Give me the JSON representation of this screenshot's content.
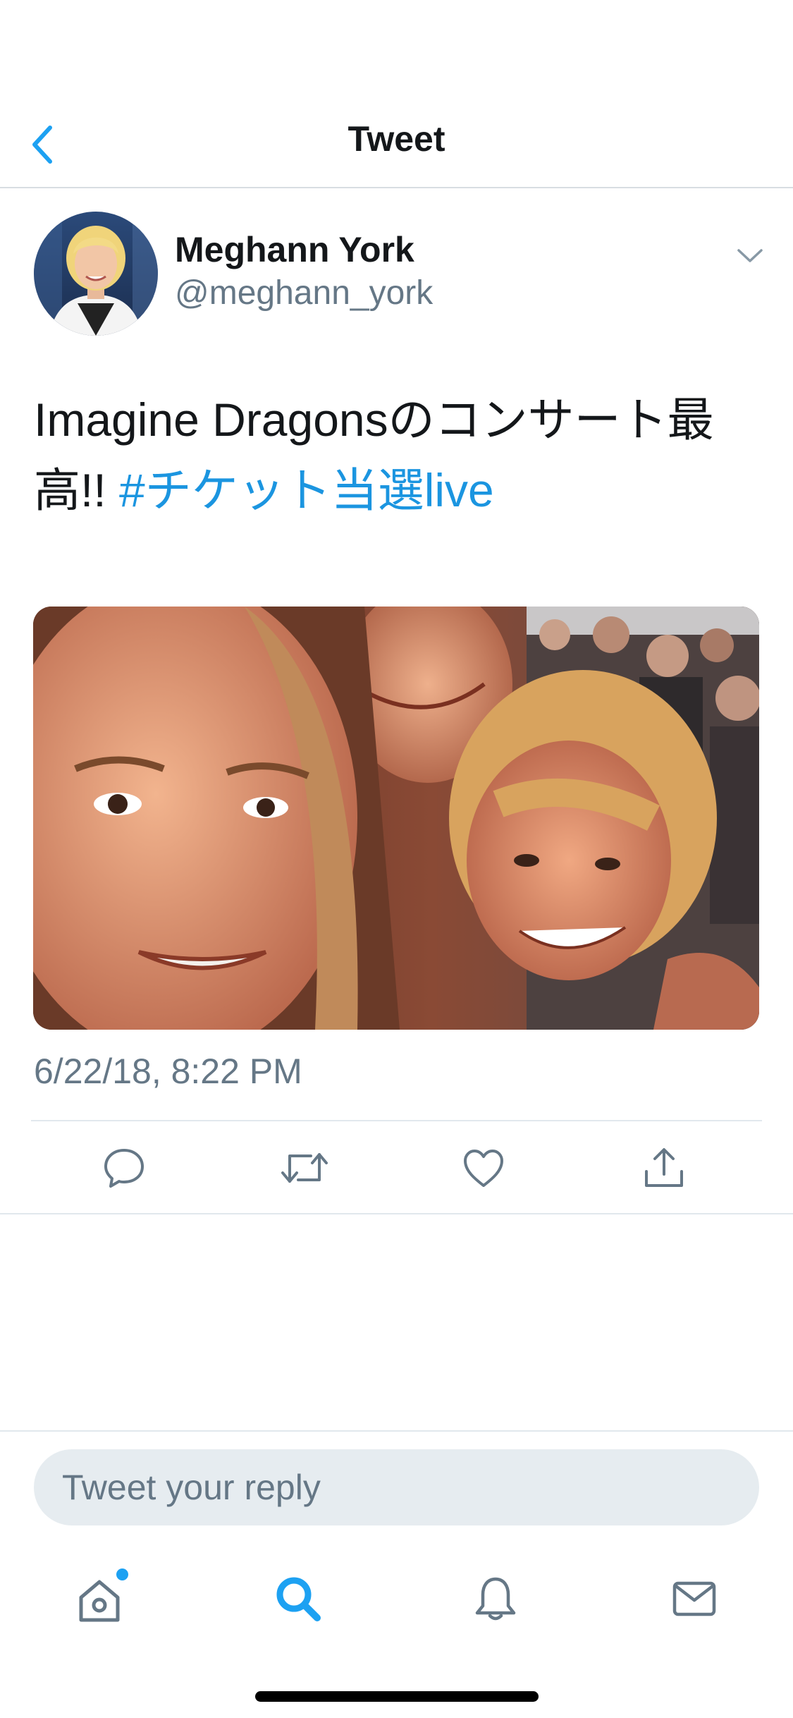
{
  "header": {
    "title": "Tweet"
  },
  "tweet": {
    "author": {
      "name": "Meghann York",
      "handle": "@meghann_york"
    },
    "text_plain": "Imagine Dragonsのコンサート最高!! ",
    "hashtag": "#チケット当選live",
    "timestamp": "6/22/18, 8:22 PM"
  },
  "actions": {
    "reply_icon": "reply-icon",
    "retweet_icon": "retweet-icon",
    "like_icon": "heart-icon",
    "share_icon": "share-icon"
  },
  "reply": {
    "placeholder": "Tweet your reply"
  },
  "tabbar": {
    "items": [
      "home-icon",
      "search-icon",
      "notifications-icon",
      "messages-icon"
    ],
    "accent_color": "#1da1f2",
    "icon_color": "#657786"
  },
  "colors": {
    "accent": "#1da1f2",
    "link": "#1b95e0",
    "text_primary": "#14171a",
    "text_secondary": "#657786"
  }
}
